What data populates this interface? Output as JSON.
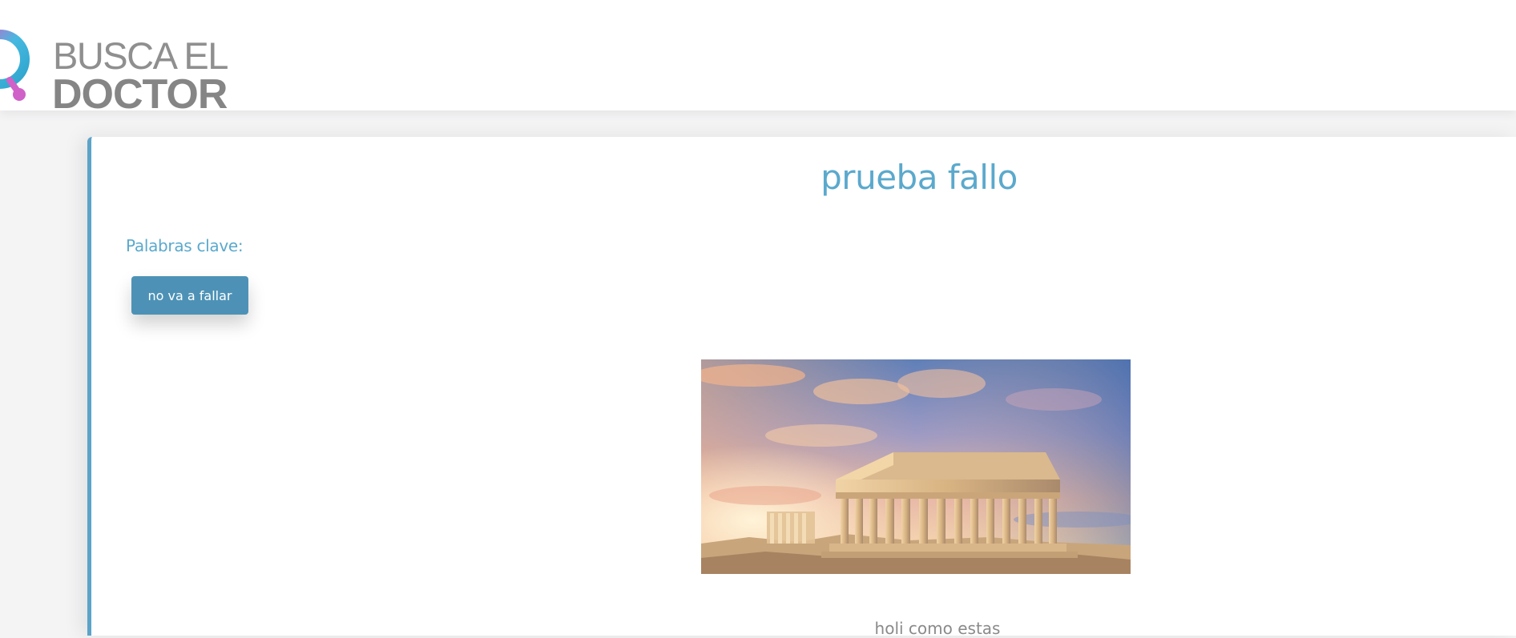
{
  "header": {
    "logo": {
      "line1": "BUSCA EL",
      "line2": "DOCTOR",
      "icon": "magnifier-logo-icon"
    }
  },
  "article": {
    "title": "prueba fallo",
    "keywords_label": "Palabras clave:",
    "keywords": [
      "no va a fallar"
    ],
    "image": {
      "subject": "parthenon-photo"
    },
    "caption": "holi como estas"
  },
  "colors": {
    "accent": "#5ba9cd",
    "button": "#4d92b6",
    "card_border": "#5ca3c8",
    "logo_gray": "#8f8f8f",
    "logo_cyan": "#3bb7d9",
    "logo_pink": "#d061c8"
  }
}
